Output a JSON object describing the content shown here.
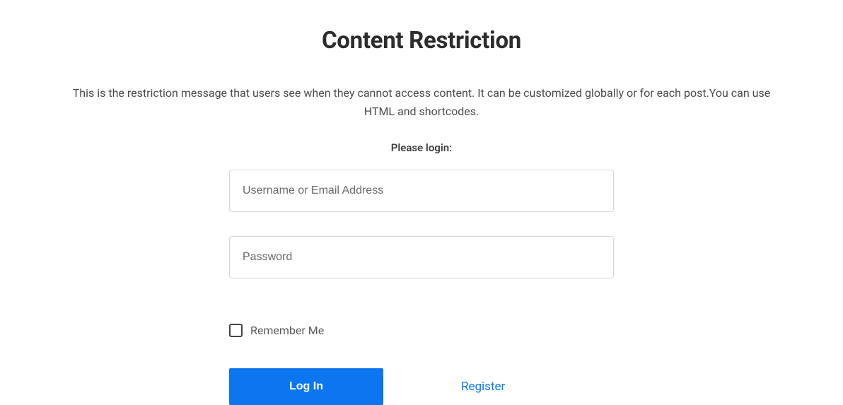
{
  "header": {
    "title": "Content Restriction"
  },
  "message": "This is the restriction message that users see when they cannot access content. It can be customized globally or for each post.You can use HTML and shortcodes.",
  "login": {
    "prompt": "Please login:",
    "username_placeholder": "Username or Email Address",
    "password_placeholder": "Password",
    "remember_label": "Remember Me",
    "submit_label": "Log In",
    "register_label": "Register"
  }
}
